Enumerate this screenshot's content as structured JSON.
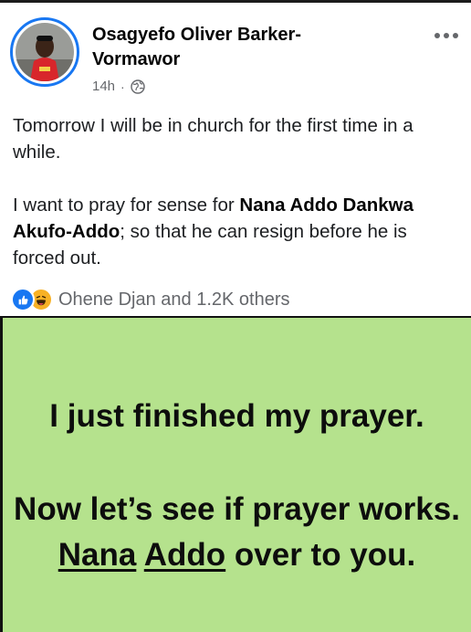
{
  "post": {
    "author_line1": "Osagyefo Oliver Barker-",
    "author_line2": "Vormawor",
    "time": "14h",
    "separator": "·",
    "audience_icon": "globe-icon",
    "menu_icon": "more-options-icon",
    "text": {
      "p1": "Tomorrow I will be in church for the first time in a while.",
      "p2_before": "I want to pray for sense for ",
      "p2_bold": "Nana Addo Dankwa Akufo-Addo",
      "p2_after": "; so that he can resign before he is forced out."
    },
    "reactions": {
      "icons": [
        "like-icon",
        "haha-icon"
      ],
      "summary": "Ohene Djan and 1.2K others"
    }
  },
  "image": {
    "background": "#b5e28d",
    "line1": "I just finished my prayer.",
    "line2": "Now let’s see if prayer works.",
    "line3_word1": "Nana",
    "line3_word2": "Addo",
    "line3_rest": " over to you."
  },
  "colors": {
    "accent": "#1877f2",
    "secondary_text": "#65676b",
    "haha": "#f7b125"
  }
}
